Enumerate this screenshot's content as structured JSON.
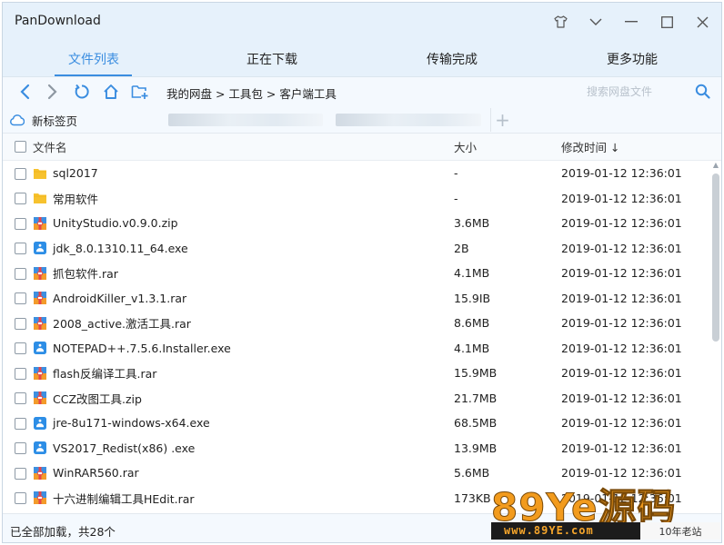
{
  "window": {
    "title": "PanDownload",
    "controls": [
      "skin-icon",
      "chevron-down-icon",
      "minimize-icon",
      "maximize-icon",
      "close-icon"
    ]
  },
  "tabs": [
    {
      "label": "文件列表",
      "active": true
    },
    {
      "label": "正在下载",
      "active": false
    },
    {
      "label": "传输完成",
      "active": false
    },
    {
      "label": "更多功能",
      "active": false
    }
  ],
  "toolbar": {
    "breadcrumb": "我的网盘 > 工具包 > 客户端工具",
    "search_placeholder": "搜索网盘文件"
  },
  "tabstrip": {
    "new_tab_label": "新标签页",
    "plus": "+"
  },
  "list": {
    "headers": {
      "name": "文件名",
      "size": "大小",
      "time": "修改时间 ↓"
    },
    "rows": [
      {
        "name": "sql2017",
        "size": "-",
        "time": "2019-01-12 12:36:01",
        "icon": "folder-icon"
      },
      {
        "name": "常用软件",
        "size": "-",
        "time": "2019-01-12 12:36:01",
        "icon": "folder-icon"
      },
      {
        "name": "UnityStudio.v0.9.0.zip",
        "size": "3.6MB",
        "time": "2019-01-12 12:36:01",
        "icon": "archive-icon"
      },
      {
        "name": "jdk_8.0.1310.11_64.exe",
        "size": "2B",
        "time": "2019-01-12 12:36:01",
        "icon": "exe-icon"
      },
      {
        "name": "抓包软件.rar",
        "size": "4.1MB",
        "time": "2019-01-12 12:36:01",
        "icon": "archive-icon"
      },
      {
        "name": "AndroidKiller_v1.3.1.rar",
        "size": "15.9IB",
        "time": "2019-01-12 12:36:01",
        "icon": "archive-icon"
      },
      {
        "name": "2008_active.激活工具.rar",
        "size": "8.6MB",
        "time": "2019-01-12 12:36:01",
        "icon": "archive-icon"
      },
      {
        "name": "NOTEPAD++.7.5.6.Installer.exe",
        "size": "4.1MB",
        "time": "2019-01-12 12:36:01",
        "icon": "exe-icon"
      },
      {
        "name": "flash反编译工具.rar",
        "size": "15.9MB",
        "time": "2019-01-12 12:36:01",
        "icon": "archive-icon"
      },
      {
        "name": "CCZ改图工具.zip",
        "size": "21.7MB",
        "time": "2019-01-12 12:36:01",
        "icon": "archive-icon"
      },
      {
        "name": "jre-8u171-windows-x64.exe",
        "size": "68.5MB",
        "time": "2019-01-12 12:36:01",
        "icon": "exe-icon"
      },
      {
        "name": "VS2017_Redist(x86) .exe",
        "size": "13.9MB",
        "time": "2019-01-12 12:36:01",
        "icon": "exe-icon"
      },
      {
        "name": "WinRAR560.rar",
        "size": "5.6MB",
        "time": "2019-01-12 12:36:01",
        "icon": "archive-icon"
      },
      {
        "name": "十六进制编辑工具HEdit.rar",
        "size": "173KB",
        "time": "2019-01-12 12:36:01",
        "icon": "archive-icon"
      }
    ]
  },
  "status": {
    "text": "已全部加载，共28个"
  },
  "watermark": {
    "main": "89Ye源码",
    "sub": "www.89YE.com",
    "badge": "10年老站"
  },
  "colors": {
    "accent": "#3a8de0",
    "folder": "#f7c22e",
    "archive_top": "#3d8fe0",
    "archive_bottom": "#f39b2b",
    "exe": "#2d8ee6"
  }
}
